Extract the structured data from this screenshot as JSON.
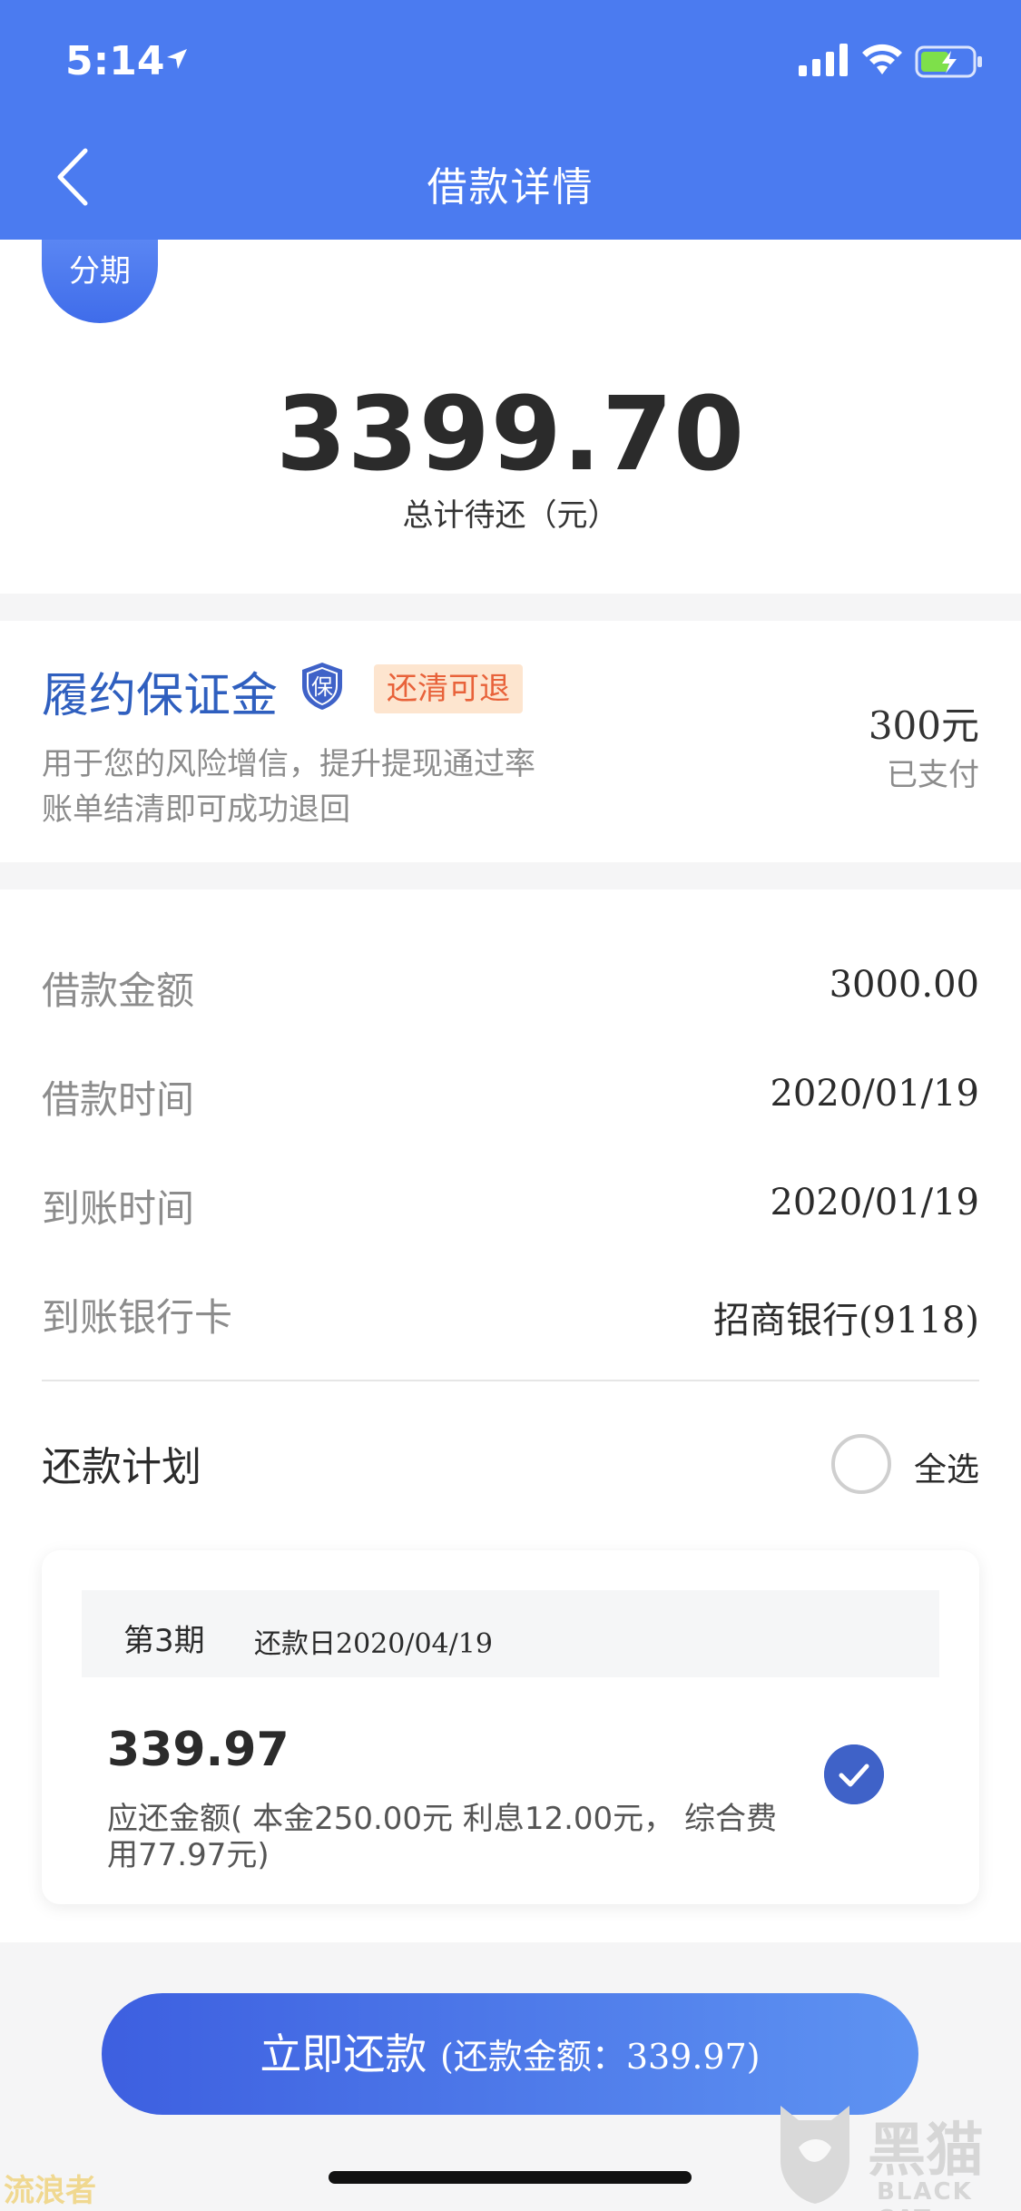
{
  "status_bar": {
    "time": "5:14"
  },
  "nav": {
    "title": "借款详情"
  },
  "summary": {
    "badge": "分期",
    "total_amount": "3399.70",
    "total_label": "总计待还（元）"
  },
  "deposit": {
    "title": "履约保证金",
    "shield_char": "保",
    "tag": "还清可退",
    "desc_line1": "用于您的风险增信，提升提现通过率",
    "desc_line2": "账单结清即可成功退回",
    "amount": "300元",
    "status": "已支付"
  },
  "details": {
    "rows": [
      {
        "label": "借款金额",
        "value": "3000.00"
      },
      {
        "label": "借款时间",
        "value": "2020/01/19"
      },
      {
        "label": "到账时间",
        "value": "2020/01/19"
      },
      {
        "label": "到账银行卡",
        "value": "招商银行(9118)"
      }
    ],
    "plan_title": "还款计划",
    "select_all": "全选"
  },
  "installment": {
    "period": "第3期",
    "due_date": "还款日2020/04/19",
    "amount": "339.97",
    "description": "应还金额( 本金250.00元 利息12.00元， 综合费用77.97元)"
  },
  "pay_button": {
    "label": "立即还款",
    "sub_label": "(还款金额：339.97)"
  },
  "watermark": {
    "left": "流浪者",
    "right_cn": "黑猫",
    "right_en": "BLACK CAT"
  },
  "colors": {
    "header": "#4b7bf0",
    "accent": "#3f62c8",
    "tag_bg": "#fde5cf",
    "tag_text": "#e8623a"
  }
}
